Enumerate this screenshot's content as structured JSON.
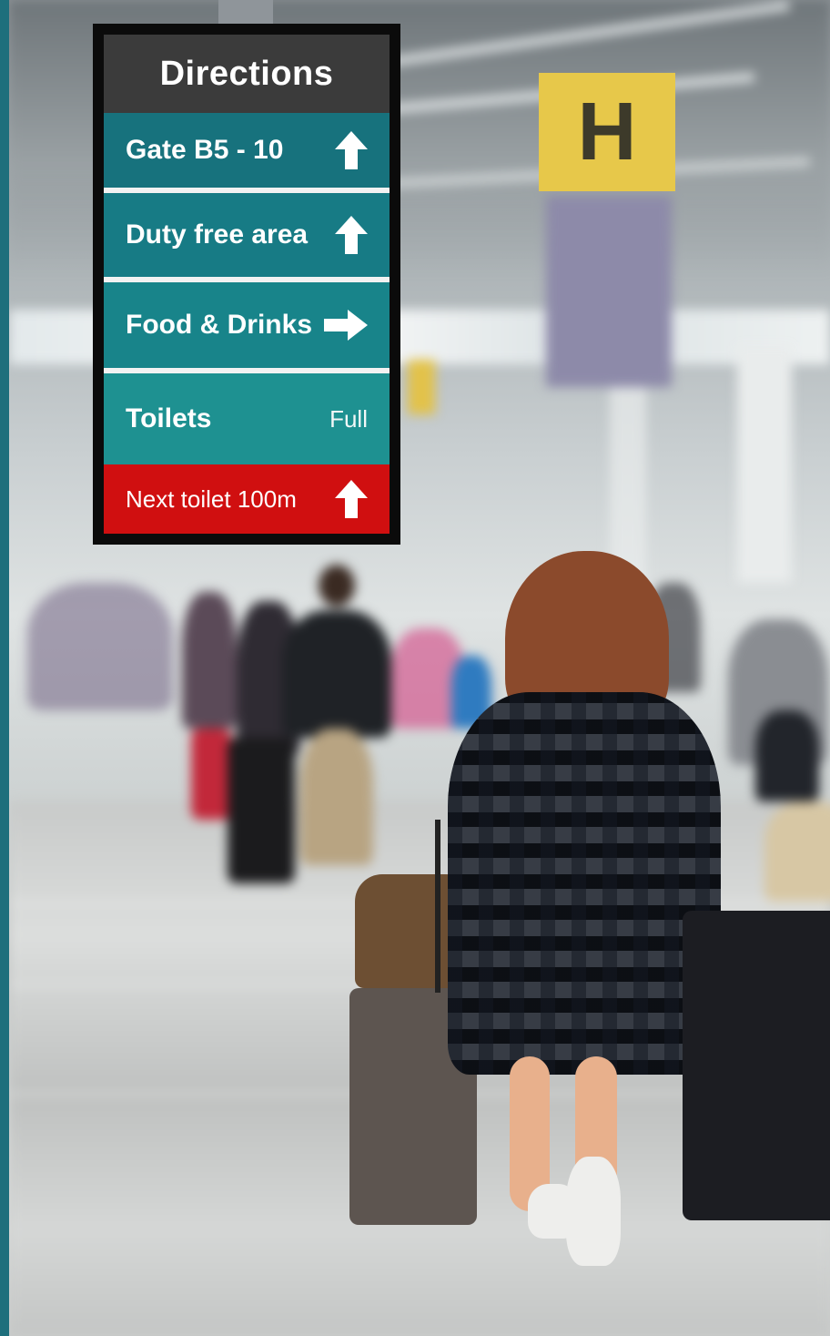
{
  "sign": {
    "title": "Directions",
    "items": [
      {
        "label": "Gate B5 - 10",
        "icon": "arrow-up-icon"
      },
      {
        "label": "Duty free area",
        "icon": "arrow-up-icon"
      },
      {
        "label": "Food & Drinks",
        "icon": "arrow-right-icon"
      },
      {
        "label": "Toilets",
        "status": "Full"
      }
    ],
    "alert": {
      "label": "Next toilet 100m",
      "icon": "arrow-up-icon"
    },
    "colors": {
      "title_bg": "#3b3b3b",
      "row_teal": "#177b85",
      "alert_red": "#d00f10",
      "frame": "#0b0b0b"
    }
  },
  "background": {
    "scene": "airport-terminal-photo",
    "overhead_sign_letter": "H"
  }
}
